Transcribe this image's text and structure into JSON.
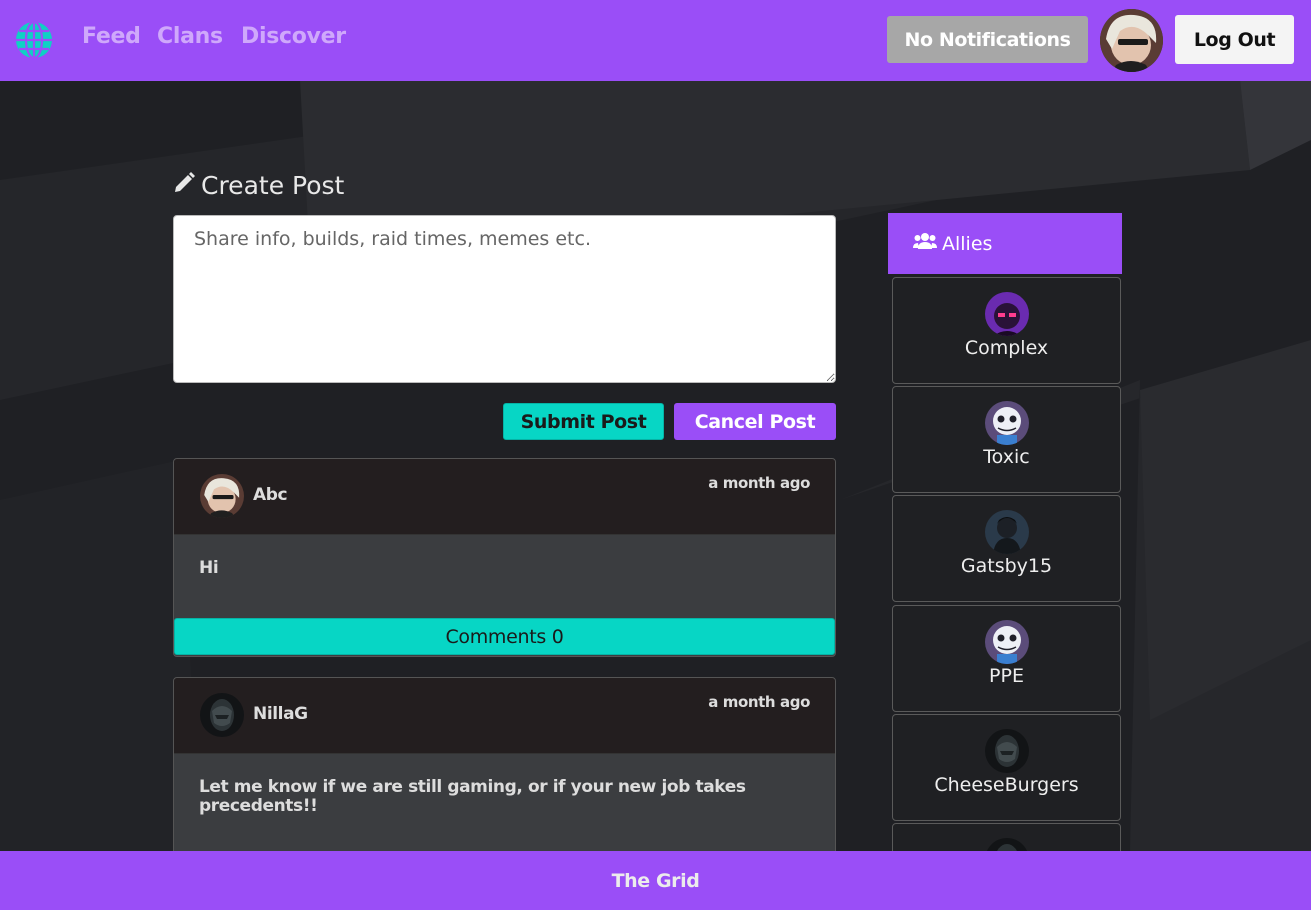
{
  "nav": {
    "links": [
      "Feed",
      "Clans",
      "Discover"
    ],
    "notifications_label": "No Notifications",
    "logout_label": "Log Out"
  },
  "create_post": {
    "title": "Create Post",
    "placeholder": "Share info, builds, raid times, memes etc.",
    "submit_label": "Submit Post",
    "cancel_label": "Cancel Post"
  },
  "posts": [
    {
      "author": "Abc",
      "time": "a month ago",
      "body": "Hi",
      "comments_label": "Comments 0"
    },
    {
      "author": "NillaG",
      "time": "a month ago",
      "body": "Let me know if we are still gaming, or if your new job takes precedents!!"
    }
  ],
  "allies": {
    "title": "Allies",
    "items": [
      {
        "name": "Complex"
      },
      {
        "name": "Toxic"
      },
      {
        "name": "Gatsby15"
      },
      {
        "name": "PPE"
      },
      {
        "name": "CheeseBurgers"
      }
    ]
  },
  "footer": {
    "text": "The Grid"
  },
  "colors": {
    "brand_purple": "#9a4ef7",
    "accent_teal": "#07d6c5",
    "background": "#1e1f23"
  }
}
